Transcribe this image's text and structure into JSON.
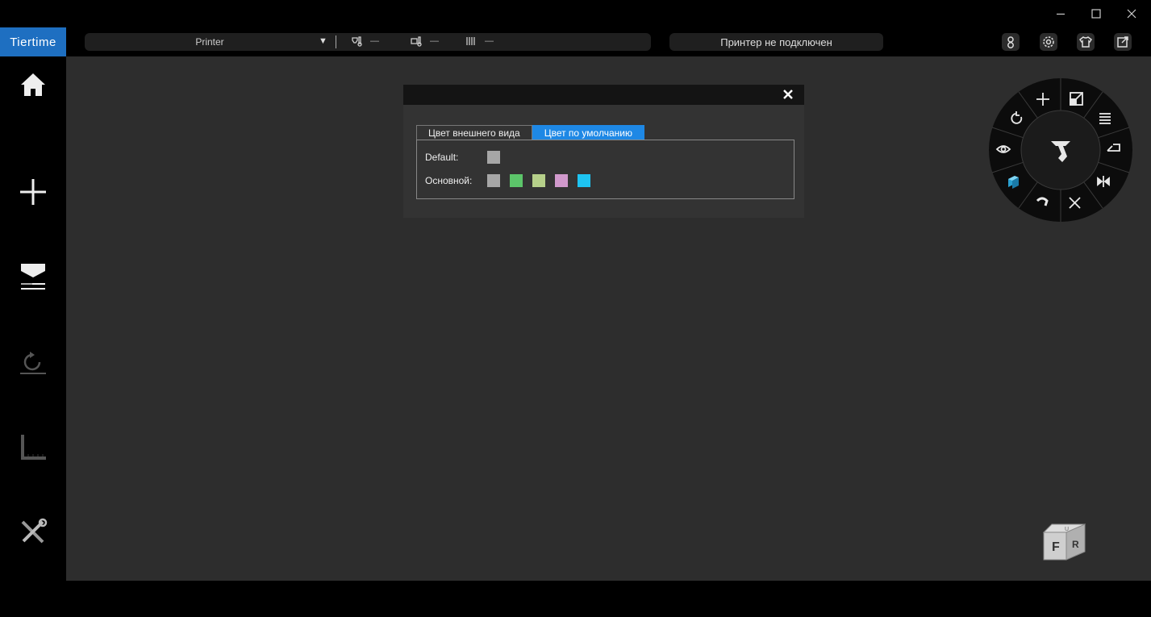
{
  "app": {
    "logo": "Tiertime",
    "printer": {
      "name": "Printer",
      "dropdown_icon": "triangle-down-icon"
    },
    "stats": [
      {
        "icon": "nozzle-temp-icon",
        "value": "—"
      },
      {
        "icon": "bed-temp-icon",
        "value": "—"
      },
      {
        "icon": "filament-icon",
        "value": "—"
      }
    ],
    "status": "Принтер не подключен",
    "top_icons": [
      "account-icon",
      "settings-gear-icon",
      "skin-shirt-icon",
      "export-icon"
    ]
  },
  "sidebar": {
    "items": [
      {
        "icon": "home-icon"
      },
      {
        "icon": "add-icon"
      },
      {
        "icon": "print-icon"
      },
      {
        "icon": "calibrate-icon"
      },
      {
        "icon": "ruler-icon"
      },
      {
        "icon": "tools-icon"
      }
    ]
  },
  "dialog": {
    "close_icon": "close-icon",
    "tabs": [
      {
        "label": "Цвет внешнего вида",
        "active": false
      },
      {
        "label": "Цвет по умолчанию",
        "active": true
      }
    ],
    "default_label": "Default:",
    "default_color": "#a6a6a6",
    "main_label": "Основной:",
    "main_colors": [
      "#a6a6a6",
      "#5cc56a",
      "#b6d08a",
      "#d199cc",
      "#1ec4f2"
    ]
  },
  "wheel": {
    "center_icon": "repair-tool-icon",
    "segments": [
      "move-icon",
      "scale-icon",
      "layers-icon",
      "undo-icon",
      "mirror-icon",
      "shrink-icon",
      "support-icon",
      "view-cube-icon",
      "eye-icon",
      "rotate-icon"
    ]
  },
  "view_cube": {
    "front": "F",
    "right": "R",
    "top": "U"
  },
  "colors": {
    "accent": "#1e6fc1",
    "tab_active": "#1e88e5"
  }
}
